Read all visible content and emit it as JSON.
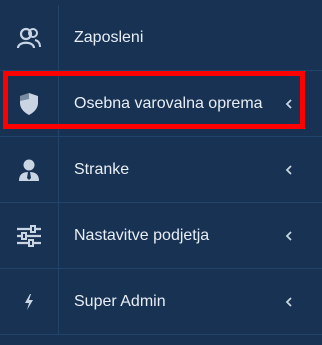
{
  "sidebar": {
    "items": [
      {
        "label": "Zaposleni",
        "icon": "users-icon",
        "has_submenu": false
      },
      {
        "label": "Osebna varovalna oprema",
        "icon": "shield-icon",
        "has_submenu": true,
        "highlighted": true
      },
      {
        "label": "Stranke",
        "icon": "user-tie-icon",
        "has_submenu": true
      },
      {
        "label": "Nastavitve podjetja",
        "icon": "sliders-icon",
        "has_submenu": true
      },
      {
        "label": "Super Admin",
        "icon": "bolt-icon",
        "has_submenu": true
      }
    ]
  },
  "colors": {
    "background": "#173252",
    "divider": "#22436a",
    "text": "#e8eef6",
    "icon": "#c9d5e3",
    "highlight": "#ff0000"
  }
}
